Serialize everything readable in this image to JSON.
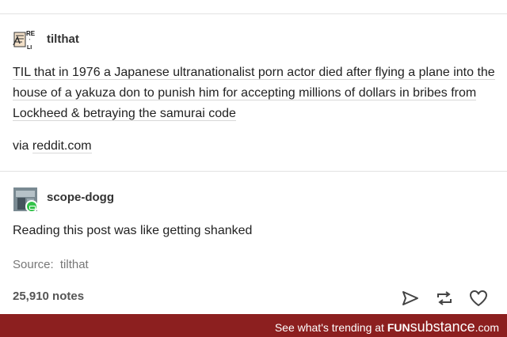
{
  "post": {
    "username": "tilthat",
    "text": "TIL that in 1976 a Japanese ultranationalist porn actor died after flying a plane into the house of a yakuza don to punish him for accepting millions of dollars in bribes from Lockheed & betraying the samurai code",
    "via_prefix": "via",
    "via_link": "reddit.com"
  },
  "reply": {
    "username": "scope-dogg",
    "text": "Reading this post was like getting shanked"
  },
  "source": {
    "label": "Source:",
    "link": "tilthat"
  },
  "notes": "25,910 notes",
  "footer": {
    "prefix": "See what's trending at",
    "brand_a": "FUN",
    "brand_b": "substance",
    "brand_c": ".com"
  },
  "colors": {
    "footer_bg": "#8c1f1f",
    "badge": "#33c34a"
  },
  "icons": [
    "share-icon",
    "reblog-icon",
    "heart-icon"
  ]
}
